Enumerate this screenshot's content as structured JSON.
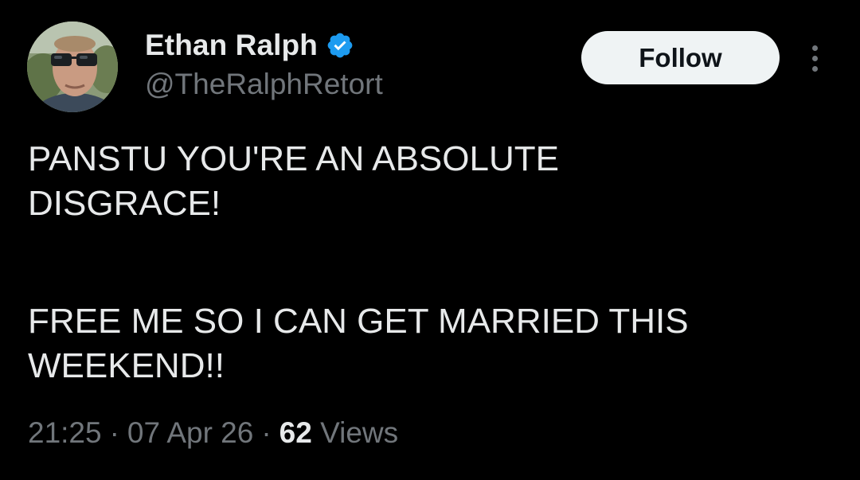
{
  "author": {
    "display_name": "Ethan Ralph",
    "handle": "@TheRalphRetort",
    "verified": true
  },
  "actions": {
    "follow_label": "Follow"
  },
  "tweet": {
    "paragraphs": [
      [
        "PANSTU YOU'RE AN ABSOLUTE",
        "DISGRACE!"
      ],
      [
        "FREE ME SO I CAN GET MARRIED THIS",
        "WEEKEND!!"
      ]
    ]
  },
  "meta": {
    "time": "21:25",
    "separator": "·",
    "date": "07 Apr 26",
    "views_count": "62",
    "views_label": "Views"
  },
  "colors": {
    "background": "#000000",
    "text_primary": "#e7e9ea",
    "text_secondary": "#71767b",
    "verified_blue": "#1d9bf0",
    "follow_bg": "#eff3f4"
  }
}
